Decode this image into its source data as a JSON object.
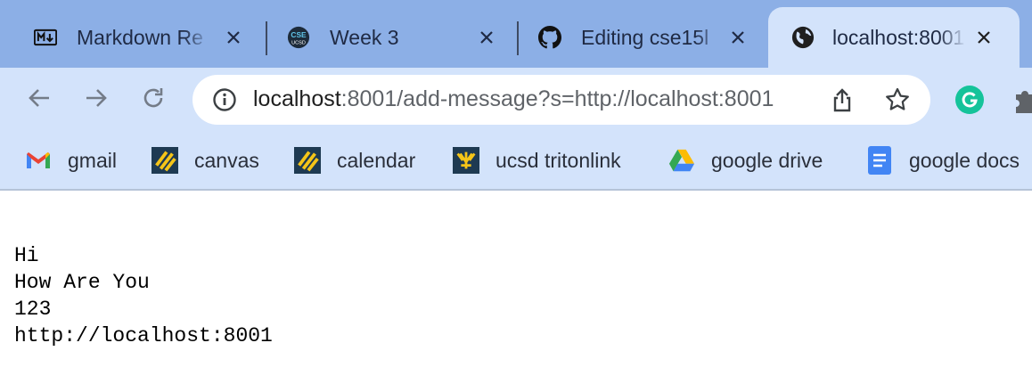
{
  "tabs": [
    {
      "title": "Markdown Re",
      "icon": "markdown-icon",
      "active": false
    },
    {
      "title": "Week 3",
      "icon": "cse-ucsd-icon",
      "active": false
    },
    {
      "title": "Editing cse15l",
      "icon": "github-icon",
      "active": false
    },
    {
      "title": "localhost:8001",
      "icon": "globe-icon",
      "active": true
    }
  ],
  "toolbar": {
    "url_host": "localhost",
    "url_rest": ":8001/add-message?s=http://localhost:8001"
  },
  "bookmarks": [
    {
      "label": "gmail",
      "icon": "gmail-icon"
    },
    {
      "label": "canvas",
      "icon": "canvas-icon"
    },
    {
      "label": "calendar",
      "icon": "calendar-icon"
    },
    {
      "label": "ucsd tritonlink",
      "icon": "tritonlink-icon"
    },
    {
      "label": "google drive",
      "icon": "google-drive-icon"
    },
    {
      "label": "google docs",
      "icon": "google-docs-icon"
    }
  ],
  "page": {
    "lines": [
      "Hi",
      "How Are You",
      "123",
      "http://localhost:8001"
    ]
  },
  "colors": {
    "tabstrip": "#8cafe6",
    "toolbar": "#d3e3fb",
    "omnibox": "#ffffff"
  }
}
